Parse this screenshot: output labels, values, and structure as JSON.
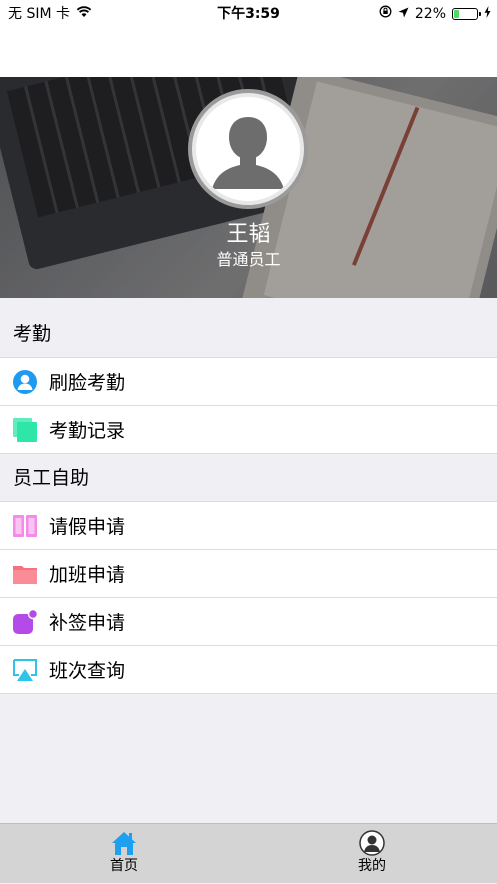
{
  "status_bar": {
    "carrier": "无 SIM 卡",
    "time": "下午3:59",
    "battery": "22%",
    "battery_level": 0.22
  },
  "profile": {
    "name": "王韬",
    "role": "普通员工"
  },
  "sections": [
    {
      "header": "考勤",
      "items": [
        {
          "label": "刷脸考勤",
          "icon": "face-user-icon",
          "color": "#1e9bf0"
        },
        {
          "label": "考勤记录",
          "icon": "record-cards-icon",
          "color": "#2ee6a8"
        }
      ]
    },
    {
      "header": "员工自助",
      "items": [
        {
          "label": "请假申请",
          "icon": "book-icon",
          "color": "#f28ce8"
        },
        {
          "label": "加班申请",
          "icon": "folder-icon",
          "color": "#f7707e"
        },
        {
          "label": "补签申请",
          "icon": "notification-badge-icon",
          "color": "#b44ae8"
        },
        {
          "label": "班次查询",
          "icon": "airplay-icon",
          "color": "#2dc4ea"
        }
      ]
    }
  ],
  "tabbar": {
    "home": "首页",
    "mine": "我的",
    "active_color": "#1ea0f0"
  }
}
